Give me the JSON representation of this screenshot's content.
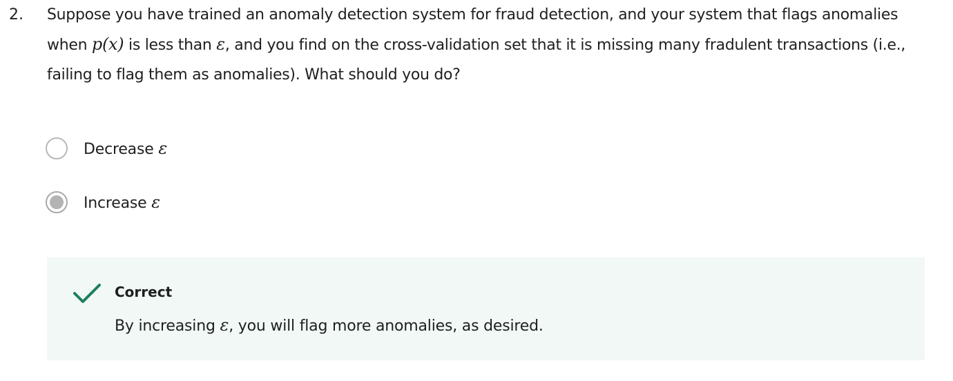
{
  "question": {
    "number": "2.",
    "text_part1": "Suppose you have trained an anomaly detection system for fraud detection, and your system that flags anomalies when ",
    "math_px": "p(x)",
    "text_part2": " is less than ",
    "math_eps": "ε",
    "text_part3": ", and you find on the cross-validation set that it is missing many fradulent transactions (i.e., failing to flag them as anomalies). What should you do?"
  },
  "options": [
    {
      "label": "Decrease ",
      "symbol": "ε",
      "selected": false
    },
    {
      "label": "Increase ",
      "symbol": "ε",
      "selected": true
    }
  ],
  "feedback": {
    "status": "Correct",
    "text_part1": "By increasing ",
    "symbol": "ε",
    "text_part2": ", you will flag more anomalies, as desired.",
    "color": "#1e7f5c"
  }
}
